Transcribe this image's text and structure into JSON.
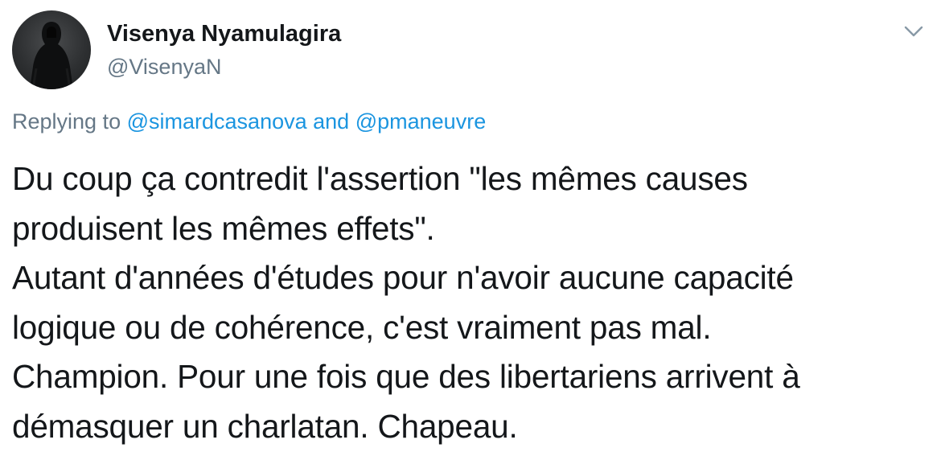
{
  "author": {
    "display_name": "Visenya Nyamulagira",
    "handle": "@VisenyaN"
  },
  "reply": {
    "prefix": "Replying to",
    "user1": "@simardcasanova",
    "conjunction": "and",
    "user2": "@pmaneuvre"
  },
  "tweet": {
    "lines": [
      "Du coup ça contredit l'assertion \"les mêmes causes",
      "produisent les mêmes effets\".",
      "Autant d'années d'études pour n'avoir aucune capacité",
      "logique ou de cohérence, c'est vraiment pas mal.",
      "Champion. Pour une fois que des libertariens arrivent à",
      "démasquer un charlatan. Chapeau."
    ]
  },
  "icons": {
    "menu": "chevron-down-icon",
    "avatar": "hooded-figure-avatar"
  },
  "colors": {
    "text": "#14171a",
    "secondary": "#657786",
    "link": "#1b95e0",
    "background": "#ffffff"
  }
}
